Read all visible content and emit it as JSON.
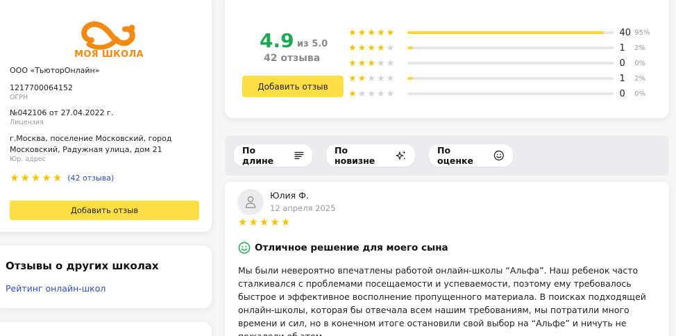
{
  "school": {
    "logo_text": "МОЯ ШКОЛА",
    "company": "ООО «ТьюторОнлайн»",
    "ogrn": "1217700064152",
    "ogrn_label": "ОГРН",
    "license": "№042106 от 27.04.2022 г.",
    "license_label": "Лицензия",
    "address_line1": "г.Москва, поселение Московский, город",
    "address_line2": "Московский, Радужная улица, дом 21",
    "address_label": "Юр. адрес",
    "rating_stars": 5,
    "reviews_link": "(42 отзыва)",
    "add_review_button": "Добавить отзыв",
    "colors": {
      "logo": "#f38a12",
      "star": "#f5c400",
      "button": "#ffdf44",
      "link": "#2d4fbf"
    }
  },
  "other_schools": {
    "title": "Отзывы о других школах",
    "link": "Рейтинг онлайн-школ"
  },
  "summary": {
    "score": "4.9",
    "out_of": "из 5.0",
    "count": "42 отзыва",
    "add_review_button": "Добавить отзыв",
    "score_color": "#1da851",
    "distribution": [
      {
        "stars": 5,
        "count": "40",
        "percent": "95%",
        "fraction": 0.95
      },
      {
        "stars": 4,
        "count": "1",
        "percent": "2%",
        "fraction": 0.02
      },
      {
        "stars": 3,
        "count": "0",
        "percent": "0%",
        "fraction": 0.0
      },
      {
        "stars": 2,
        "count": "1",
        "percent": "2%",
        "fraction": 0.02
      },
      {
        "stars": 1,
        "count": "0",
        "percent": "0%",
        "fraction": 0.0
      }
    ]
  },
  "sort": {
    "by_length": "По длине",
    "by_newest": "По новизне",
    "by_rating": "По оценке"
  },
  "review": {
    "author": "Юлия Ф.",
    "date": "12 апреля 2025",
    "stars": 5,
    "title": "Отличное решение для моего сына",
    "text": "Мы были невероятно впечатлены работой онлайн-школы “Альфа”. Наш ребенок часто сталкивался с проблемами посещаемости и успеваемости, поэтому ему требовалось быстрое и эффективное восполнение пропущенного материала. В поисках подходящей онлайн-школы, которая бы отвечала всем нашим требованиям, мы потратили много времени и сил, но в конечном итоге остановили свой выбор на “Альфе” и ничуть не пожалели об этом."
  }
}
